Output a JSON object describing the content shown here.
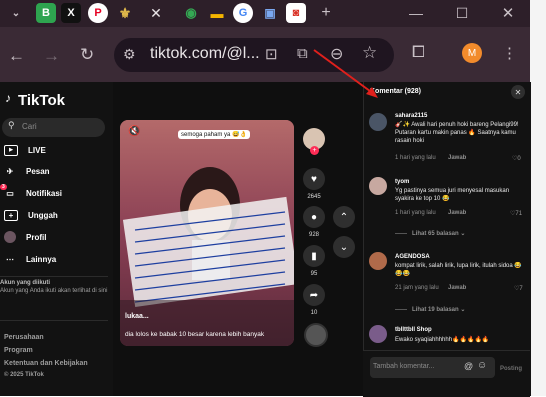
{
  "browser": {
    "tabs": [
      {
        "icon": "blogger-icon",
        "glyph": "B",
        "color": "#2ea44f"
      },
      {
        "icon": "x-icon",
        "glyph": "X",
        "color": "#ffffff"
      },
      {
        "icon": "pinterest-icon",
        "glyph": "P",
        "color": "#e60023"
      },
      {
        "icon": "emblem-icon",
        "glyph": "⚜",
        "color": "#e0b84a"
      },
      {
        "icon": "maps-icon",
        "glyph": "◉",
        "color": "#34a853"
      },
      {
        "icon": "slides-icon",
        "glyph": "▬",
        "color": "#f4b400"
      },
      {
        "icon": "google-icon",
        "glyph": "G",
        "color": "#4285f4"
      },
      {
        "icon": "classroom-icon",
        "glyph": "▣",
        "color": "#1e8e3e"
      },
      {
        "icon": "app-icon",
        "glyph": "◙",
        "color": "#d93025"
      }
    ],
    "new_tab": "+",
    "url": "tiktok.com/@l...",
    "profile_initial": "M",
    "accent": "#f28b2c"
  },
  "sidebar": {
    "logo": "TikTok",
    "search_placeholder": "Cari",
    "nav": [
      {
        "icon": "live-icon",
        "label": "LIVE"
      },
      {
        "icon": "messages-icon",
        "label": "Pesan"
      },
      {
        "icon": "notifications-icon",
        "label": "Notifikasi",
        "badge": "3"
      },
      {
        "icon": "upload-icon",
        "label": "Unggah"
      },
      {
        "icon": "profile-icon",
        "label": "Profil"
      },
      {
        "icon": "more-icon",
        "label": "Lainnya"
      }
    ],
    "following_title": "Akun yang diikuti",
    "following_text": "Akun yang Anda ikuti akan terlihat di sini",
    "footer": [
      "Perusahaan",
      "Program",
      "Ketentuan dan Kebijakan"
    ],
    "copyright": "© 2025 TikTok"
  },
  "video": {
    "sticker_text": "semoga paham ya 😅👌",
    "handle": "lukaa...",
    "caption": "dia lolos ke babak 10 besar karena  lebih banyak",
    "likes": "2645",
    "comments": "928",
    "saves": "95",
    "shares": "10"
  },
  "comments": {
    "title": "Komentar (928)",
    "items": [
      {
        "user": "sahara2115",
        "text": "🎸✨ Awali hari penuh hoki bareng Pelangi99! Putaran kartu makin panas 🔥 Saatnya kamu rasain hoki",
        "date": "1 hari yang lalu",
        "reply": "Jawab",
        "likes": "0",
        "avatar_color": "#4a5566"
      },
      {
        "user": "tyom",
        "text": "Yg pastinya semua juri menyesal masukan syakira ke top 10 😂",
        "date": "1 hari yang lalu",
        "reply": "Jawab",
        "likes": "71",
        "more": "Lihat 65 balasan",
        "avatar_color": "#c7a8a0"
      },
      {
        "user": "AGENDOSA",
        "text": "kompat lirik, salah lirik, lupa lirik, itulah sidoa 😂😂😂",
        "date": "21 jam yang lalu",
        "reply": "Jawab",
        "likes": "7",
        "more": "Lihat 19 balasan",
        "avatar_color": "#b06a4a"
      },
      {
        "user": "tbllttbll Shop",
        "text": "Ewako syaqiahhhhhh🔥🔥🔥🔥🔥",
        "avatar_color": "#7a5c8a"
      }
    ],
    "input_placeholder": "Tambah komentar...",
    "post_label": "Posting"
  },
  "annotation_color": "#e0201c"
}
